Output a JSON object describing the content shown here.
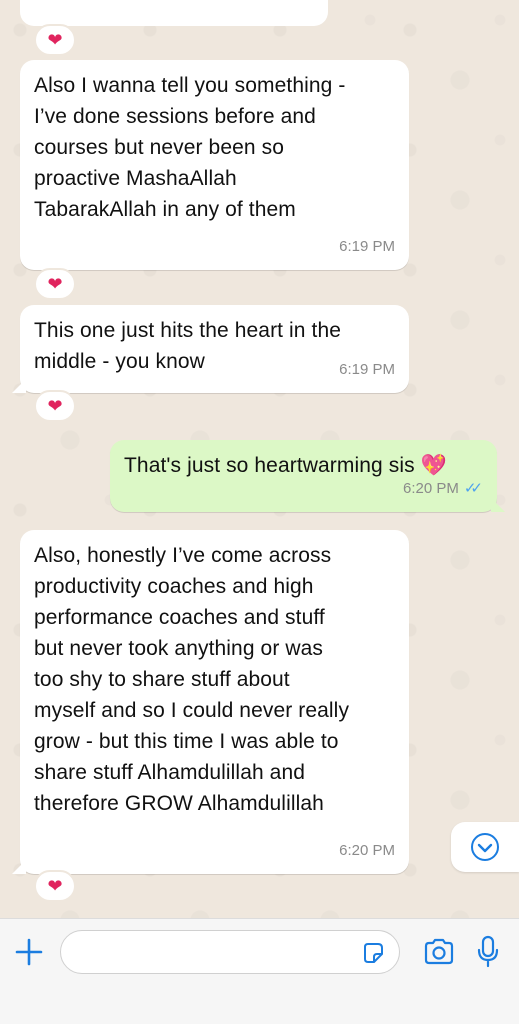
{
  "messages": [
    {
      "direction": "in",
      "text": "Also I wanna tell you something -\nI’ve done sessions before and\ncourses but never been so\nproactive MashaAllah\nTabarakAllah in any of them",
      "time": "6:19 PM",
      "reaction": "❤"
    },
    {
      "direction": "in",
      "text": "This one just hits the heart in the\nmiddle - you know",
      "time": "6:19 PM",
      "reaction": "❤"
    },
    {
      "direction": "out",
      "text": "That's just so heartwarming sis 💖",
      "time": "6:20 PM",
      "status": "read"
    },
    {
      "direction": "in",
      "text": "Also, honestly I’ve come across\nproductivity coaches and high\nperformance coaches and stuff\nbut never took anything or was\ntoo shy to share stuff about\nmyself and so I could never really\ngrow - but this time I was able to\nshare stuff Alhamdulillah and\ntherefore GROW Alhamdulillah",
      "time": "6:20 PM",
      "reaction": "❤"
    }
  ],
  "top_reaction": "❤",
  "read_ticks": "✓✓",
  "colors": {
    "incoming_bubble": "#ffffff",
    "outgoing_bubble": "#dcf8c6",
    "read_ticks": "#4fa3ee",
    "accent_icons": "#1b7de0",
    "reaction": "#e0245e"
  },
  "input": {
    "placeholder": "",
    "value": ""
  },
  "icons": [
    "plus-icon",
    "sticker-icon",
    "camera-icon",
    "microphone-icon",
    "chevron-down-icon"
  ]
}
